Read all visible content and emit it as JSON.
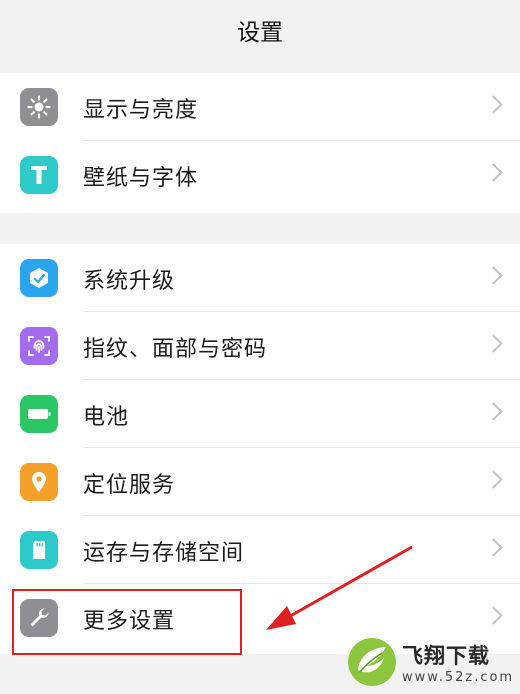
{
  "header": {
    "title": "设置"
  },
  "groups": [
    {
      "items": [
        {
          "label": "显示与亮度",
          "icon": "brightness-icon",
          "color": "#8e8e93"
        },
        {
          "label": "壁纸与字体",
          "icon": "text-font-icon",
          "color": "#2ec9c9"
        }
      ]
    },
    {
      "items": [
        {
          "label": "系统升级",
          "icon": "system-update-icon",
          "color": "#2ba6ee"
        },
        {
          "label": "指纹、面部与密码",
          "icon": "fingerprint-icon",
          "color": "#a56bee"
        },
        {
          "label": "电池",
          "icon": "battery-icon",
          "color": "#2bc766"
        },
        {
          "label": "定位服务",
          "icon": "location-pin-icon",
          "color": "#f5a02a"
        },
        {
          "label": "运存与存储空间",
          "icon": "sd-card-icon",
          "color": "#2ec9c9"
        },
        {
          "label": "更多设置",
          "icon": "wrench-icon",
          "color": "#8e8e93"
        }
      ]
    }
  ],
  "annotation": {
    "highlight_color": "#e02020"
  },
  "watermark": {
    "title": "飞翔下载",
    "url": "www.52z.com"
  }
}
